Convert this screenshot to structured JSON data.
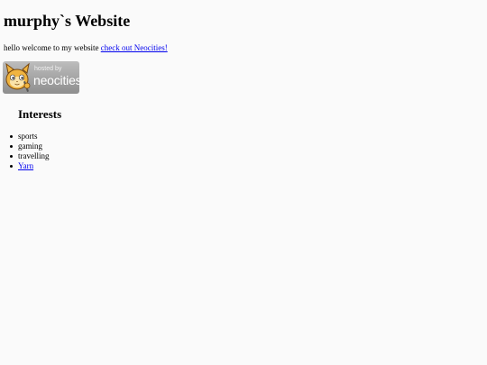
{
  "header": {
    "title": "murphy`s Website"
  },
  "intro": {
    "text": "hello welcome to my website ",
    "link_label": "check out Neocities!"
  },
  "badge": {
    "small_text": "hosted by",
    "big_text": "neocities",
    "icon": "neocities-cat-icon"
  },
  "interests": {
    "heading": "Interests",
    "items": [
      {
        "label": "sports",
        "is_link": false
      },
      {
        "label": "gaming",
        "is_link": false
      },
      {
        "label": "travelling",
        "is_link": false
      },
      {
        "label": "Yarn",
        "is_link": true
      }
    ]
  },
  "colors": {
    "link": "#0000ee",
    "background": "#fafafa",
    "badge_gradient_top": "#bdbdbd",
    "badge_gradient_bottom": "#8e8e8e"
  }
}
